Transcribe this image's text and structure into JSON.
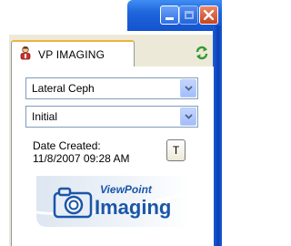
{
  "window": {
    "controls": {
      "minimize_icon": "minimize-icon",
      "maximize_icon": "maximize-icon",
      "close_icon": "close-icon"
    },
    "colors": {
      "titlebar": "#1f65dc",
      "panel_bg": "#ece9d8",
      "close": "#c8421f"
    }
  },
  "tab": {
    "label": "VP IMAGING",
    "icon": "person-icon",
    "refresh_icon": "refresh-icon"
  },
  "form": {
    "view_select": {
      "value": "Lateral Ceph"
    },
    "stage_select": {
      "value": "Initial"
    },
    "date_created_label": "Date Created:",
    "date_created_value": "11/8/2007 09:28 AM",
    "t_button_label": "T"
  },
  "logo": {
    "line1": "ViewPoint",
    "line2": "Imaging",
    "icon": "camera-icon",
    "color": "#1a56a7"
  }
}
